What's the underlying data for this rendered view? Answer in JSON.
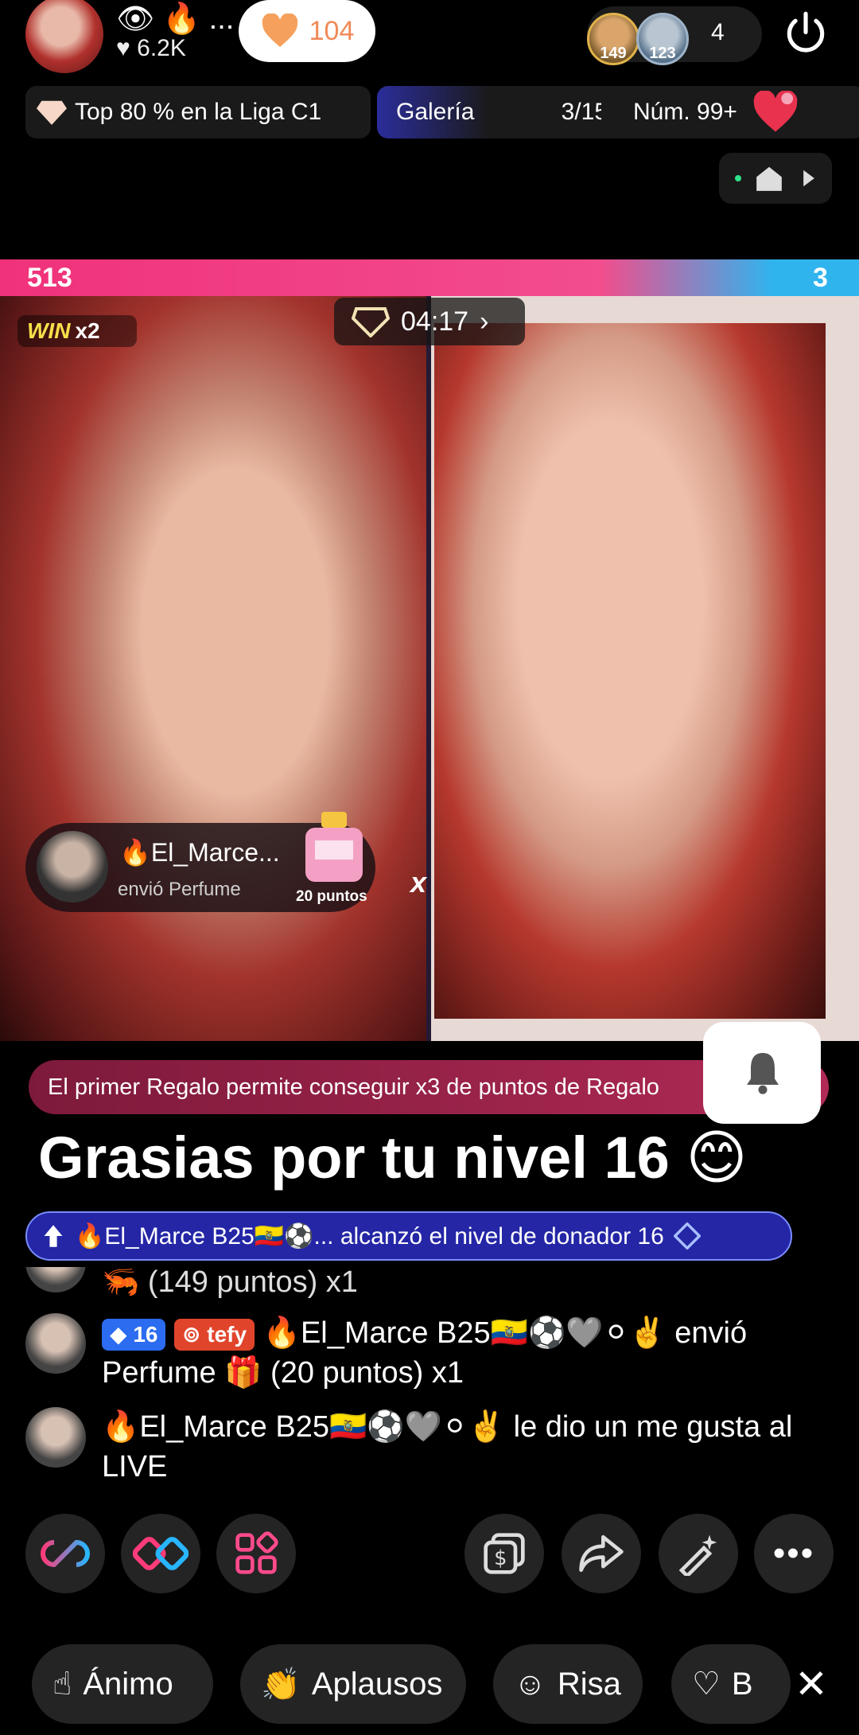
{
  "host": {
    "stats": "👁 🔥 ...",
    "likes": "♥ 6.2K",
    "heart_count": "104"
  },
  "viewers": {
    "avatar1_badge": "149",
    "avatar2_badge": "123",
    "count": "4"
  },
  "chips": {
    "league": "Top 80 % en la Liga C1",
    "gallery_label": "Galería",
    "gallery_count": "3/15",
    "rank": "Núm. 99+"
  },
  "battle": {
    "left_score": "513",
    "right_score": "3",
    "win_label": "WIN",
    "win_multiplier": "x2",
    "timer": "04:17",
    "vs": "x"
  },
  "gift_toast": {
    "user": "🔥El_Marce...",
    "action": "envió Perfume",
    "points": "20 puntos"
  },
  "banner": {
    "text": "El primer Regalo permite conseguir x3 de puntos de Regalo"
  },
  "title": "Grasias por tu nivel 16 😊",
  "level_notice": {
    "text": "🔥El_Marce B25🇪🇨⚽... alcanzó el nivel de donador 16"
  },
  "chat": [
    {
      "text": "🦐 (149 puntos) x1"
    },
    {
      "level": "16",
      "fan_badge": "tefy",
      "text": "🔥El_Marce B25🇪🇨⚽🩶⚪✌️ envió Perfume 🎁 (20 puntos) x1"
    },
    {
      "text": "🔥El_Marce B25🇪🇨⚽🩶⚪✌️ le dio un me gusta al LIVE"
    }
  ],
  "bottom_buttons": [
    "Ánimo",
    "Aplausos",
    "Risa",
    "B"
  ]
}
